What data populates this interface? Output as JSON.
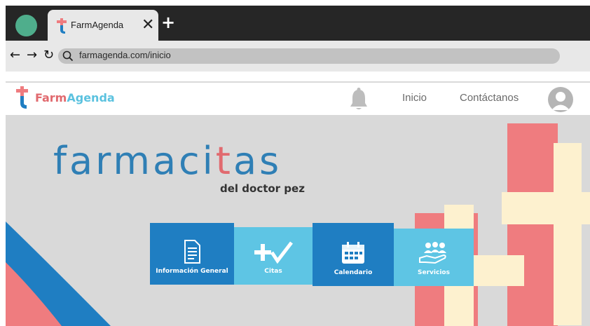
{
  "browser": {
    "tab_title": "FarmAgenda",
    "close_symbol": "✕",
    "new_tab_symbol": "+",
    "back_symbol": "←",
    "forward_symbol": "→",
    "reload_symbol": "↻",
    "url": "farmagenda.com/inicio"
  },
  "header": {
    "logo_part1": "Farm",
    "logo_part2": "Agenda",
    "nav": [
      {
        "label": "Inicio"
      },
      {
        "label": "Contáctanos"
      }
    ]
  },
  "hero": {
    "wordmark_prefix": "farmaci",
    "wordmark_accent": "t",
    "wordmark_suffix": "as",
    "byline": "del doctor pez",
    "cards": [
      {
        "label": "Información General",
        "icon": "document-icon"
      },
      {
        "label": "Citas",
        "icon": "plus-check-icon"
      },
      {
        "label": "Calendario",
        "icon": "calendar-icon"
      },
      {
        "label": "Servicios",
        "icon": "people-hand-icon"
      }
    ]
  },
  "colors": {
    "coral": "#ef7c7f",
    "cream": "#fdf1cf",
    "dark_blue": "#1f7ec2",
    "light_blue": "#5ec5e4",
    "brand_red": "#e16a6f",
    "brand_cyan": "#5bc2df"
  }
}
